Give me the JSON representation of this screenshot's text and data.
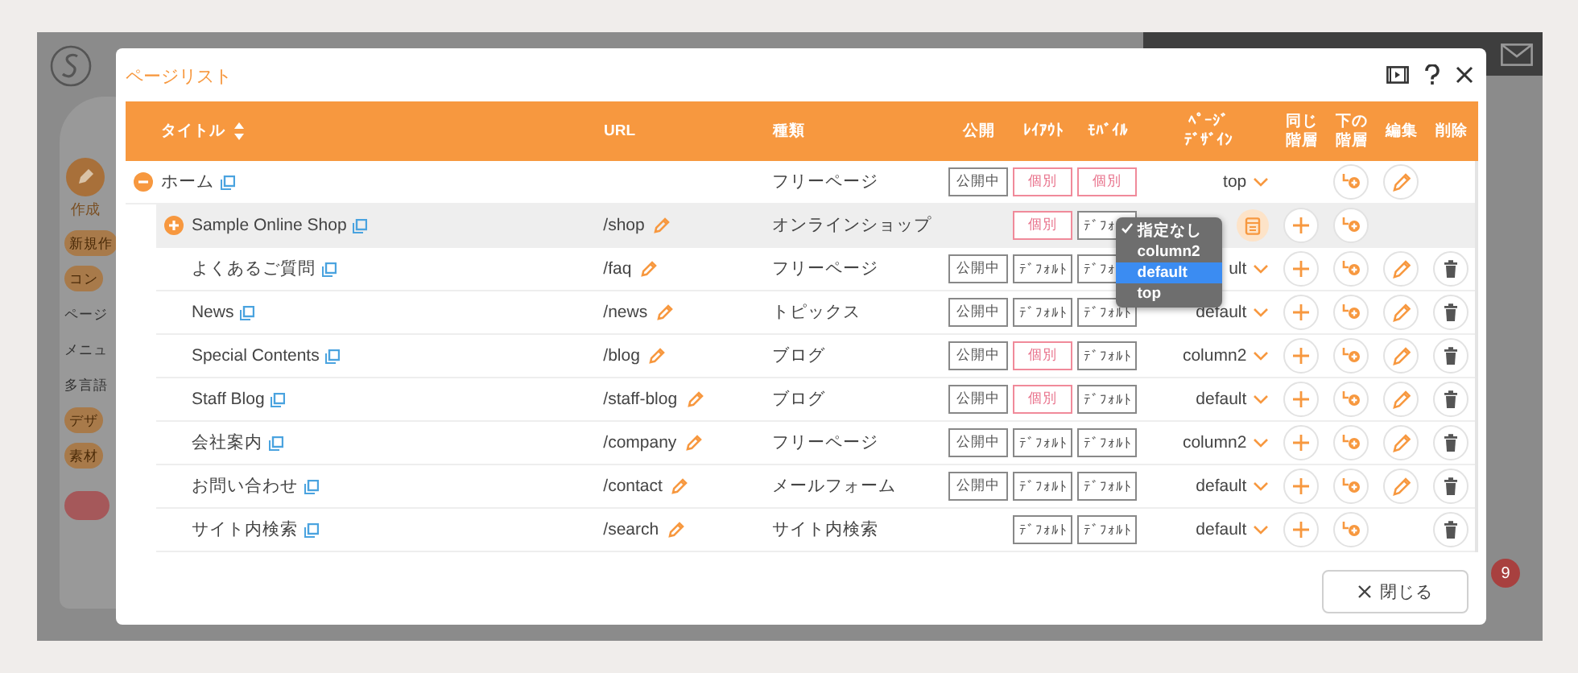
{
  "backdrop": {
    "sidebar": {
      "create_label": "作成",
      "items": [
        {
          "label": "新規作",
          "kind": "tag"
        },
        {
          "label": "コン",
          "kind": "tag"
        },
        {
          "label": "ページ",
          "kind": "plain"
        },
        {
          "label": "メニュ",
          "kind": "plain"
        },
        {
          "label": "多言語",
          "kind": "plain"
        },
        {
          "label": "デザ",
          "kind": "tag"
        },
        {
          "label": "素材",
          "kind": "tag"
        }
      ]
    },
    "badge": "9"
  },
  "dialog": {
    "title": "ページリスト",
    "close_label": "閉じる"
  },
  "columns": {
    "title": "タイトル",
    "url": "URL",
    "type": "種類",
    "public": "公開",
    "layout": "ﾚｲｱｳﾄ",
    "mobile": "ﾓﾊﾞｲﾙ",
    "design": [
      "ﾍﾟｰｼﾞ",
      "ﾃﾞｻﾞｲﾝ"
    ],
    "same_level": [
      "同じ",
      "階層"
    ],
    "below": [
      "下の",
      "階層"
    ],
    "edit": "編集",
    "delete": "削除"
  },
  "pages": [
    {
      "title": "ホーム",
      "type": "フリーページ",
      "public": "公開中",
      "layout": {
        "label": "個別",
        "kind": "custom"
      },
      "mobile": {
        "label": "個別",
        "kind": "custom"
      },
      "design": "top",
      "expandable": true,
      "expanded": true,
      "selected": false,
      "same_level": false,
      "below": true,
      "edit": true,
      "delete": false,
      "children": [
        {
          "title": "Sample Online Shop",
          "url": "/shop",
          "type": "オンラインショップ",
          "layout": {
            "label": "個別",
            "kind": "custom"
          },
          "mobile": {
            "label": "ﾃﾞﾌｫ",
            "kind": "default"
          },
          "design_menu": {
            "options": [
              {
                "label": "指定なし",
                "checked": true,
                "highlighted": false
              },
              {
                "label": "column2",
                "checked": false,
                "highlighted": false
              },
              {
                "label": "default",
                "checked": false,
                "highlighted": true
              },
              {
                "label": "top",
                "checked": false,
                "highlighted": false
              }
            ]
          },
          "expandable": true,
          "expanded": false,
          "selected": true,
          "same_level": true,
          "below": true,
          "edit": false,
          "delete": false
        },
        {
          "title": "よくあるご質問",
          "url": "/faq",
          "type": "フリーページ",
          "public": "公開中",
          "layout": {
            "label": "ﾃﾞﾌｫﾙﾄ",
            "kind": "default"
          },
          "mobile": {
            "label": "ﾃﾞﾌｫ",
            "kind": "default"
          },
          "design": "ult",
          "expandable": false,
          "selected": false,
          "same_level": true,
          "below": true,
          "edit": true,
          "delete": true
        },
        {
          "title": "News",
          "url": "/news",
          "type": "トピックス",
          "public": "公開中",
          "layout": {
            "label": "ﾃﾞﾌｫﾙﾄ",
            "kind": "default"
          },
          "mobile": {
            "label": "ﾃﾞﾌｫﾙﾄ",
            "kind": "default"
          },
          "design": "default",
          "expandable": false,
          "selected": false,
          "same_level": true,
          "below": true,
          "edit": true,
          "delete": true
        },
        {
          "title": "Special Contents",
          "url": "/blog",
          "type": "ブログ",
          "public": "公開中",
          "layout": {
            "label": "個別",
            "kind": "custom"
          },
          "mobile": {
            "label": "ﾃﾞﾌｫﾙﾄ",
            "kind": "default"
          },
          "design": "column2",
          "expandable": false,
          "selected": false,
          "same_level": true,
          "below": true,
          "edit": true,
          "delete": true
        },
        {
          "title": "Staff Blog",
          "url": "/staff-blog",
          "type": "ブログ",
          "public": "公開中",
          "layout": {
            "label": "個別",
            "kind": "custom"
          },
          "mobile": {
            "label": "ﾃﾞﾌｫﾙﾄ",
            "kind": "default"
          },
          "design": "default",
          "expandable": false,
          "selected": false,
          "same_level": true,
          "below": true,
          "edit": true,
          "delete": true
        },
        {
          "title": "会社案内",
          "url": "/company",
          "type": "フリーページ",
          "public": "公開中",
          "layout": {
            "label": "ﾃﾞﾌｫﾙﾄ",
            "kind": "default"
          },
          "mobile": {
            "label": "ﾃﾞﾌｫﾙﾄ",
            "kind": "default"
          },
          "design": "column2",
          "expandable": false,
          "selected": false,
          "same_level": true,
          "below": true,
          "edit": true,
          "delete": true
        },
        {
          "title": "お問い合わせ",
          "url": "/contact",
          "type": "メールフォーム",
          "public": "公開中",
          "layout": {
            "label": "ﾃﾞﾌｫﾙﾄ",
            "kind": "default"
          },
          "mobile": {
            "label": "ﾃﾞﾌｫﾙﾄ",
            "kind": "default"
          },
          "design": "default",
          "expandable": false,
          "selected": false,
          "same_level": true,
          "below": true,
          "edit": true,
          "delete": true
        },
        {
          "title": "サイト内検索",
          "url": "/search",
          "type": "サイト内検索",
          "layout": {
            "label": "ﾃﾞﾌｫﾙﾄ",
            "kind": "default"
          },
          "mobile": {
            "label": "ﾃﾞﾌｫﾙﾄ",
            "kind": "default"
          },
          "design": "default",
          "expandable": false,
          "selected": false,
          "same_level": true,
          "below": true,
          "edit": false,
          "delete": true
        }
      ]
    }
  ]
}
